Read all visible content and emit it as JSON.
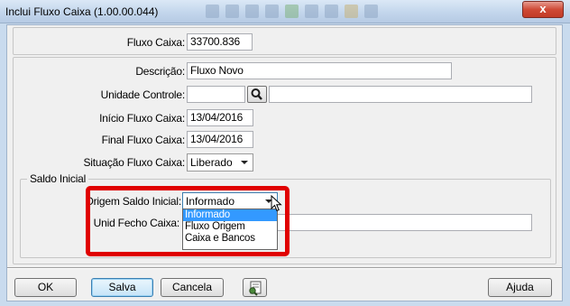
{
  "window": {
    "title": "Inclui Fluxo Caixa (1.00.00.044)",
    "close_glyph": "x"
  },
  "form": {
    "fluxo_caixa": {
      "label": "Fluxo Caixa:",
      "value": "33700.836"
    },
    "descricao": {
      "label": "Descrição:",
      "value": "Fluxo Novo"
    },
    "unidade_controle": {
      "label": "Unidade Controle:",
      "code": "",
      "name": "",
      "lookup_icon": "magnifier-icon"
    },
    "inicio": {
      "label": "Início Fluxo Caixa:",
      "value": "13/04/2016"
    },
    "final": {
      "label": "Final Fluxo Caixa:",
      "value": "13/04/2016"
    },
    "situacao": {
      "label": "Situação Fluxo Caixa:",
      "value": "Liberado"
    }
  },
  "saldo_inicial": {
    "legend": "Saldo Inicial",
    "origem": {
      "label": "Origem Saldo Inicial:",
      "value": "Informado",
      "options": [
        "Informado",
        "Fluxo Origem",
        "Caixa e Bancos"
      ],
      "selected_index": 0
    },
    "unid_fecho": {
      "label": "Unid Fecho Caixa:",
      "value": ""
    }
  },
  "buttons": {
    "ok": "OK",
    "salva": "Salva",
    "cancela": "Cancela",
    "ajuda": "Ajuda",
    "extra_icon": "document-edit-icon"
  },
  "colors": {
    "highlight": "#e00000",
    "selection": "#3399ff",
    "title_bar": "#c3d6ec",
    "close_button": "#cf4a36"
  }
}
